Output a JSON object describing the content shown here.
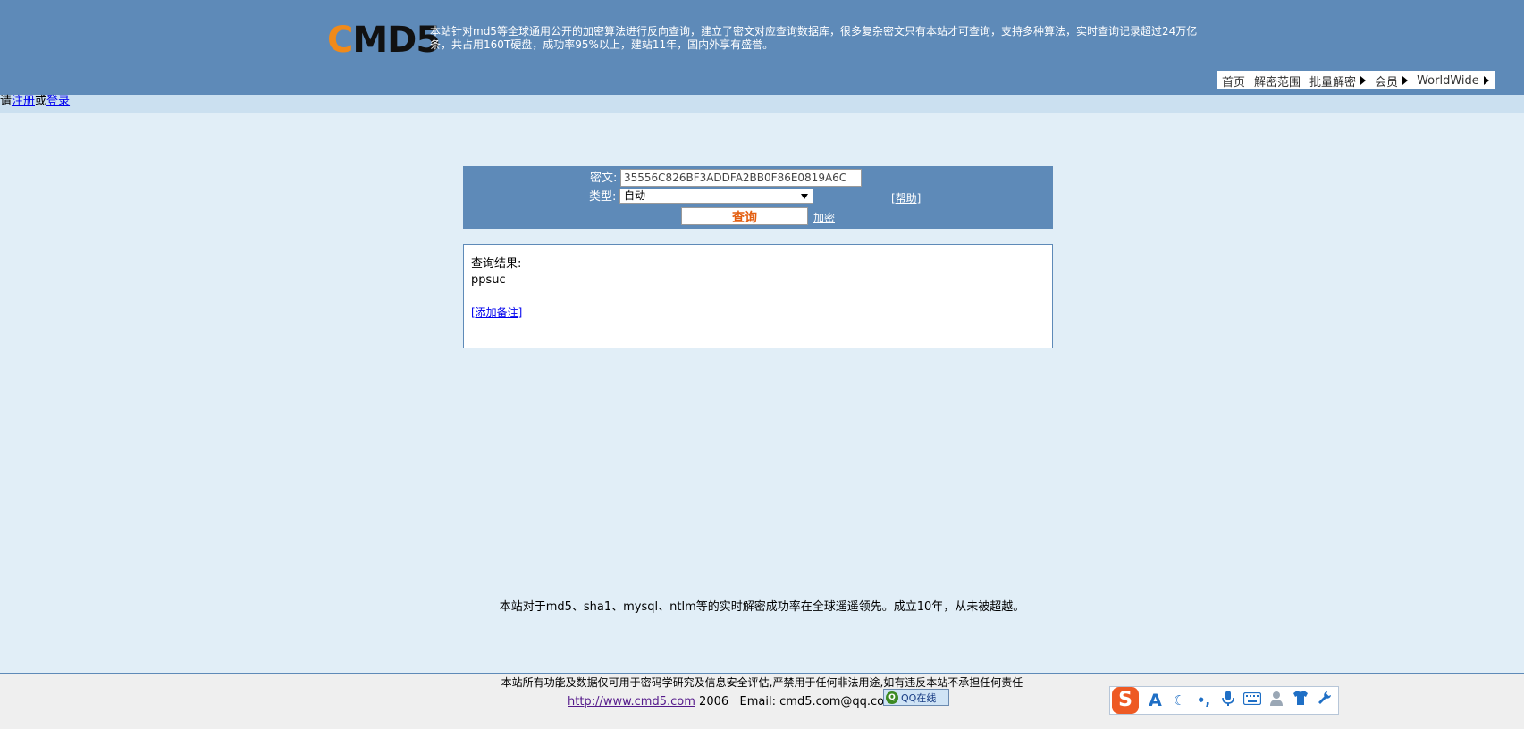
{
  "header": {
    "logo_c": "C",
    "logo_rest": "MD5",
    "intro": "本站针对md5等全球通用公开的加密算法进行反向查询，建立了密文对应查询数据库，很多复杂密文只有本站才可查询，支持多种算法，实时查询记录超过24万亿条，共占用160T硬盘，成功率95%以上，建站11年，国内外享有盛誉。"
  },
  "nav": {
    "items": [
      "首页",
      "解密范围",
      "批量解密",
      "会员",
      "WorldWide"
    ]
  },
  "login_bar": {
    "prefix": "请",
    "register": "注册",
    "or": "或",
    "login": "登录"
  },
  "query": {
    "cipher_label": "密文:",
    "cipher_value": "35556C826BF3ADDFA2BB0F86E0819A6C",
    "type_label": "类型:",
    "type_value": "自动",
    "help": "[帮助]",
    "submit": "查询",
    "encrypt": "加密"
  },
  "result": {
    "label": "查询结果:",
    "value": "ppsuc",
    "add_note": "[添加备注]"
  },
  "slogan": "本站对于md5、sha1、mysql、ntlm等的实时解密成功率在全球遥遥领先。成立10年，从未被超越。",
  "footer": {
    "disclaimer": "本站所有功能及数据仅可用于密码学研究及信息安全评估,严禁用于任何非法用途,如有违反本站不承担任何责任",
    "url": "http://www.cmd5.com",
    "year": "2006",
    "email_label": "Email:",
    "email": "cmd5.com@qq.com",
    "qq_badge": "QQ在线"
  },
  "ime": {
    "logo": "S",
    "icons": [
      "font-icon",
      "moon-icon",
      "punctuation-icon",
      "microphone-icon",
      "keyboard-icon",
      "user-icon",
      "skin-shirt-icon",
      "wrench-icon"
    ],
    "colors": {
      "accent": "#1f6fc5",
      "logo": "#ee5a24"
    }
  },
  "colors": {
    "header_bg": "#5e8ab8",
    "page_bg": "#e1eef7",
    "login_bar_bg": "#cbe0f0",
    "submit_text": "#e35e10",
    "logo_accent": "#f08a1a"
  }
}
